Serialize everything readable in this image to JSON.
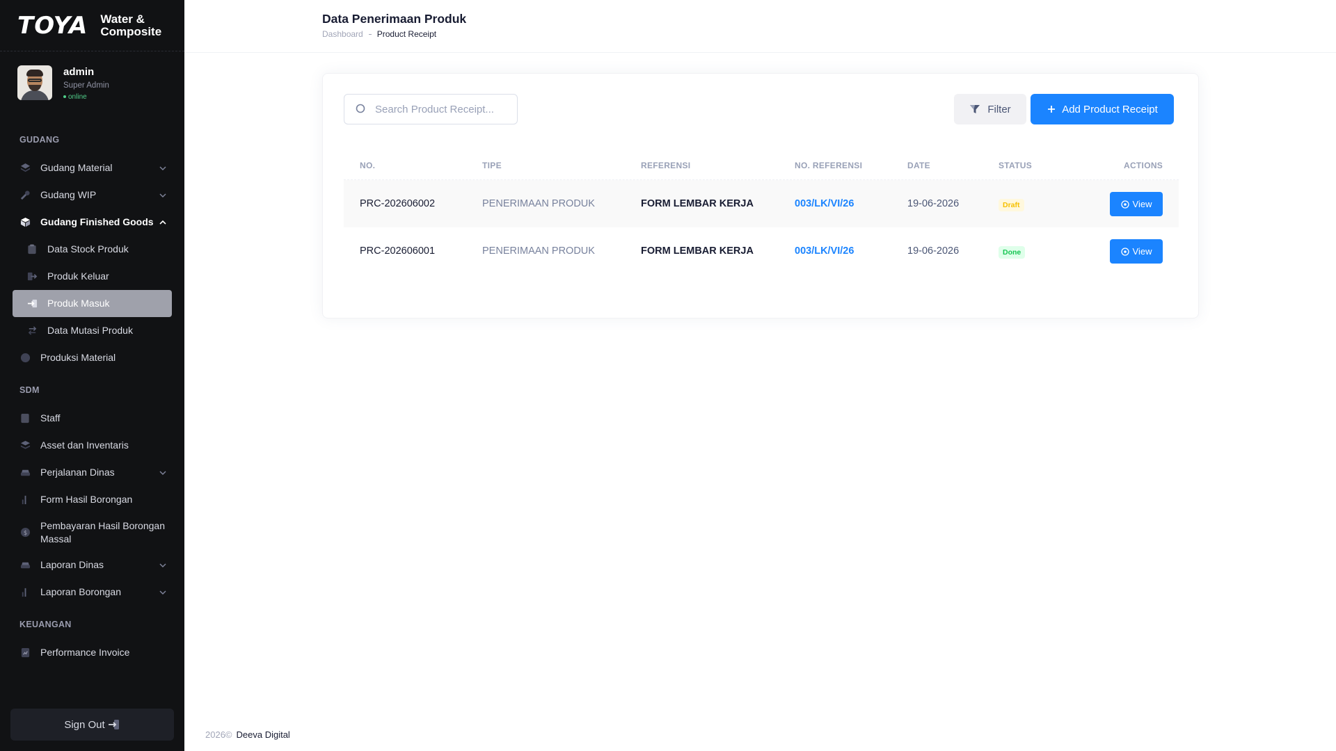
{
  "brand": {
    "mark": "TOYA",
    "line1": "Water &",
    "line2": "Composite"
  },
  "user": {
    "name": "admin",
    "role": "Super Admin",
    "status": "online"
  },
  "sidebar": {
    "sections": [
      {
        "title": "GUDANG",
        "items": [
          {
            "label": "Gudang Material",
            "icon": "layers-icon",
            "expandable": true,
            "expanded": false
          },
          {
            "label": "Gudang WIP",
            "icon": "wrench-icon",
            "expandable": true,
            "expanded": false
          },
          {
            "label": "Gudang Finished Goods",
            "icon": "box-icon",
            "expandable": true,
            "expanded": true,
            "children": [
              {
                "label": "Data Stock Produk",
                "icon": "clipboard-icon"
              },
              {
                "label": "Produk Keluar",
                "icon": "exit-icon"
              },
              {
                "label": "Produk Masuk",
                "icon": "enter-icon",
                "selected": true
              },
              {
                "label": "Data Mutasi Produk",
                "icon": "swap-icon"
              }
            ]
          },
          {
            "label": "Produksi Material",
            "icon": "circle-icon",
            "expandable": false
          }
        ]
      },
      {
        "title": "SDM",
        "items": [
          {
            "label": "Staff",
            "icon": "badge-icon"
          },
          {
            "label": "Asset dan Inventaris",
            "icon": "stack-icon"
          },
          {
            "label": "Perjalanan Dinas",
            "icon": "car-icon",
            "expandable": true
          },
          {
            "label": "Form Hasil Borongan",
            "icon": "bar-chart-icon"
          },
          {
            "label": "Pembayaran Hasil Borongan Massal",
            "icon": "dollar-icon"
          },
          {
            "label": "Laporan Dinas",
            "icon": "car-icon",
            "expandable": true
          },
          {
            "label": "Laporan Borongan",
            "icon": "bar-chart-icon",
            "expandable": true
          }
        ]
      },
      {
        "title": "KEUANGAN",
        "items": [
          {
            "label": "Performance Invoice",
            "icon": "file-chart-icon"
          }
        ]
      }
    ],
    "signout": "Sign Out"
  },
  "header": {
    "title": "Data Penerimaan Produk",
    "breadcrumb": [
      "Dashboard",
      "Product Receipt"
    ]
  },
  "toolbar": {
    "search_placeholder": "Search Product Receipt...",
    "filter_label": "Filter",
    "add_label": "Add Product Receipt"
  },
  "table": {
    "columns": [
      "NO.",
      "TIPE",
      "REFERENSI",
      "NO. REFERENSI",
      "DATE",
      "STATUS",
      "ACTIONS"
    ],
    "rows": [
      {
        "no": "PRC-202606002",
        "tipe": "PENERIMAAN PRODUK",
        "ref": "FORM LEMBAR KERJA",
        "noref": "003/LK/VI/26",
        "date": "19-06-2026",
        "status": "Draft",
        "action": "View"
      },
      {
        "no": "PRC-202606001",
        "tipe": "PENERIMAAN PRODUK",
        "ref": "FORM LEMBAR KERJA",
        "noref": "003/LK/VI/26",
        "date": "19-06-2026",
        "status": "Done",
        "action": "View"
      }
    ]
  },
  "footer": {
    "year": "2026©",
    "company": "Deeva Digital"
  },
  "colors": {
    "sidebar_bg": "#111214",
    "primary": "#1b84ff",
    "draft": "#f6c000",
    "done": "#17c653"
  }
}
